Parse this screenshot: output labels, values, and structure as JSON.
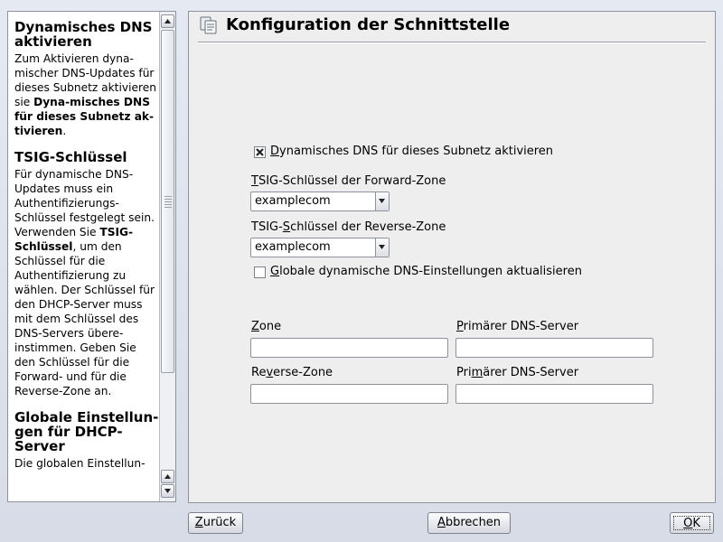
{
  "help": {
    "sections": [
      {
        "heading": "Dynamisches DNS aktivieren",
        "text_before": "Zum Aktivieren dyna-mischer DNS-Updates für dieses Subnetz aktivieren sie ",
        "bold": "Dyna-misches DNS für dieses Subnetz ak-tivieren",
        "text_after": "."
      },
      {
        "heading": "TSIG-Schlüssel",
        "text_before": "Für dynamische DNS-Updates muss ein Authentifizierungs-Schlüssel festgelegt sein. Verwenden Sie ",
        "bold": "TSIG-Schlüssel",
        "text_after": ", um den Schlüssel für die Authentifizierung zu wählen. Der Schlüssel für den DHCP-Server muss mit dem Schlüssel des DNS-Servers übere-instimmen. Geben Sie den Schlüssel für die Forward- und für die Reverse-Zone an."
      },
      {
        "heading": "Globale Einstellun-gen für DHCP-Server",
        "text_before": "Die globalen Einstellun-",
        "bold": "",
        "text_after": ""
      }
    ]
  },
  "main": {
    "title": "Konfiguration der Schnittstelle",
    "enable_ddns": {
      "checked": true,
      "key": "D",
      "label": "ynamisches DNS für dieses Subnetz aktivieren"
    },
    "forward_key": {
      "label_key": "T",
      "label": "SIG-Schlüssel der Forward-Zone",
      "value": "examplecom"
    },
    "reverse_key": {
      "label_pre": "TSIG-",
      "label_key": "S",
      "label": "chlüssel der Reverse-Zone",
      "value": "examplecom"
    },
    "update_global": {
      "checked": false,
      "key": "G",
      "label": "lobale dynamische DNS-Einstellungen aktualisieren"
    },
    "zone": {
      "key": "Z",
      "label": "one",
      "value": ""
    },
    "zone_dns": {
      "key": "P",
      "label": "rimärer DNS-Server",
      "value": ""
    },
    "reverse_zone": {
      "label_pre": "Re",
      "key": "v",
      "label": "erse-Zone",
      "value": ""
    },
    "reverse_dns": {
      "label_pre": "Pri",
      "key": "m",
      "label": "ärer DNS-Server",
      "value": ""
    }
  },
  "buttons": {
    "back": {
      "key": "Z",
      "label": "urück"
    },
    "cancel": {
      "key": "A",
      "label": "bbrechen"
    },
    "ok": {
      "key": "O",
      "label": "K"
    }
  },
  "colors": {
    "background": "#dde2eb",
    "panel": "#eeeeee",
    "border": "#8e929a"
  }
}
